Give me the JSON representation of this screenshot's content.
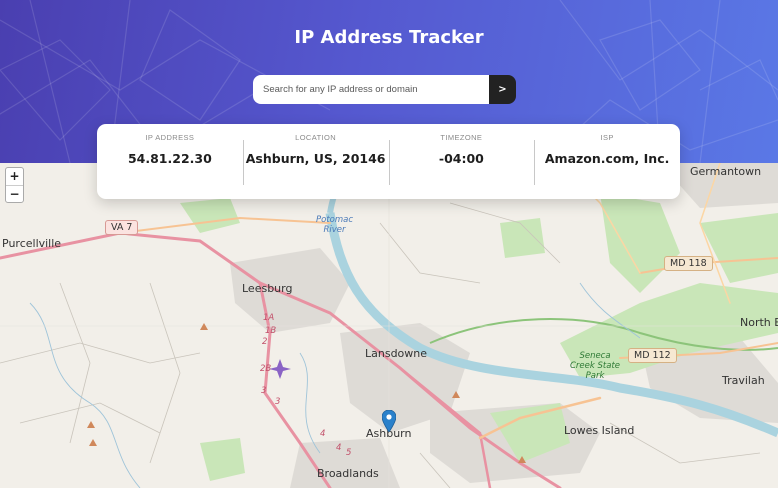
{
  "header": {
    "title": "IP Address Tracker"
  },
  "search": {
    "placeholder": "Search for any IP address or domain",
    "button_label": ">"
  },
  "info": [
    {
      "label": "IP ADDRESS",
      "value": "54.81.22.30"
    },
    {
      "label": "LOCATION",
      "value": "Ashburn, US, 20146"
    },
    {
      "label": "TIMEZONE",
      "value": "-04:00"
    },
    {
      "label": "ISP",
      "value": "Amazon.com, Inc."
    }
  ],
  "map": {
    "zoom_in": "+",
    "zoom_out": "−",
    "places": [
      "Purcellville",
      "Leesburg",
      "Lansdowne",
      "Ashburn",
      "Broadlands",
      "Lowes Island",
      "Germantown",
      "North B",
      "Travilah"
    ],
    "water": [
      "Potomac",
      "River"
    ],
    "park": [
      "Seneca",
      "Creek State",
      "Park"
    ],
    "shields": [
      "VA 7",
      "MD 118",
      "MD 112"
    ],
    "exits": [
      "1A",
      "1B",
      "2",
      "2B",
      "3",
      "3",
      "4",
      "4",
      "5"
    ]
  }
}
